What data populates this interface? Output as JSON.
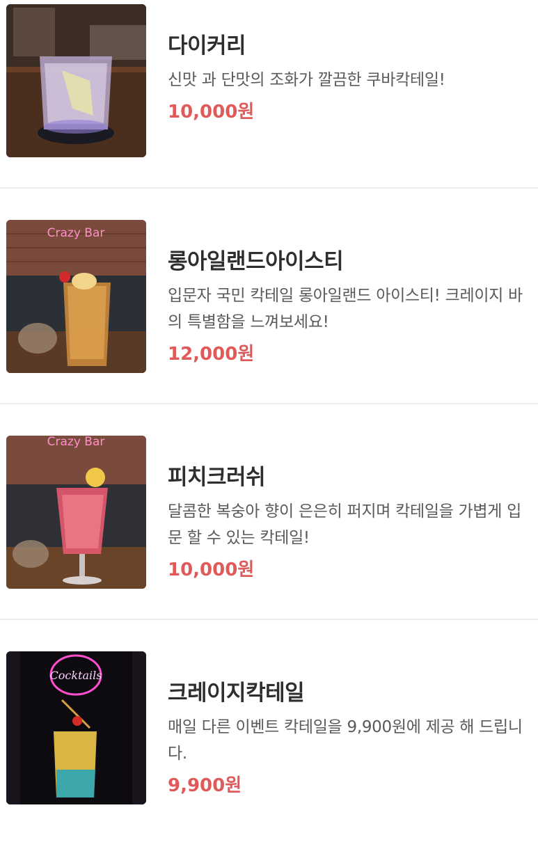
{
  "colors": {
    "price": "#e05a5a",
    "name": "#2e2e2e",
    "desc": "#5a5a5a",
    "divider": "#eeeeee"
  },
  "items": [
    {
      "name": "다이커리",
      "desc": "신맛 과 단맛의 조화가 깔끔한 쿠바칵테일!",
      "price": "10,000원",
      "image_icon": "daiquiri-photo"
    },
    {
      "name": "롱아일랜드아이스티",
      "desc": "입문자 국민 칵테일 롱아일랜드 아이스티! 크레이지 바의 특별함을 느껴보세요!",
      "price": "12,000원",
      "image_icon": "long-island-photo",
      "sign_text": "Crazy Bar"
    },
    {
      "name": "피치크러쉬",
      "desc": "달콤한 복숭아 향이 은은히 퍼지며 칵테일을 가볍게 입문 할 수 있는 칵테일!",
      "price": "10,000원",
      "image_icon": "peach-crush-photo",
      "sign_text": "Crazy Bar"
    },
    {
      "name": "크레이지칵테일",
      "desc": "매일 다른 이벤트 칵테일을 9,900원에 제공 해 드립니다.",
      "price": "9,900원",
      "image_icon": "crazy-cocktail-photo",
      "sign_text": "Cocktails"
    }
  ]
}
